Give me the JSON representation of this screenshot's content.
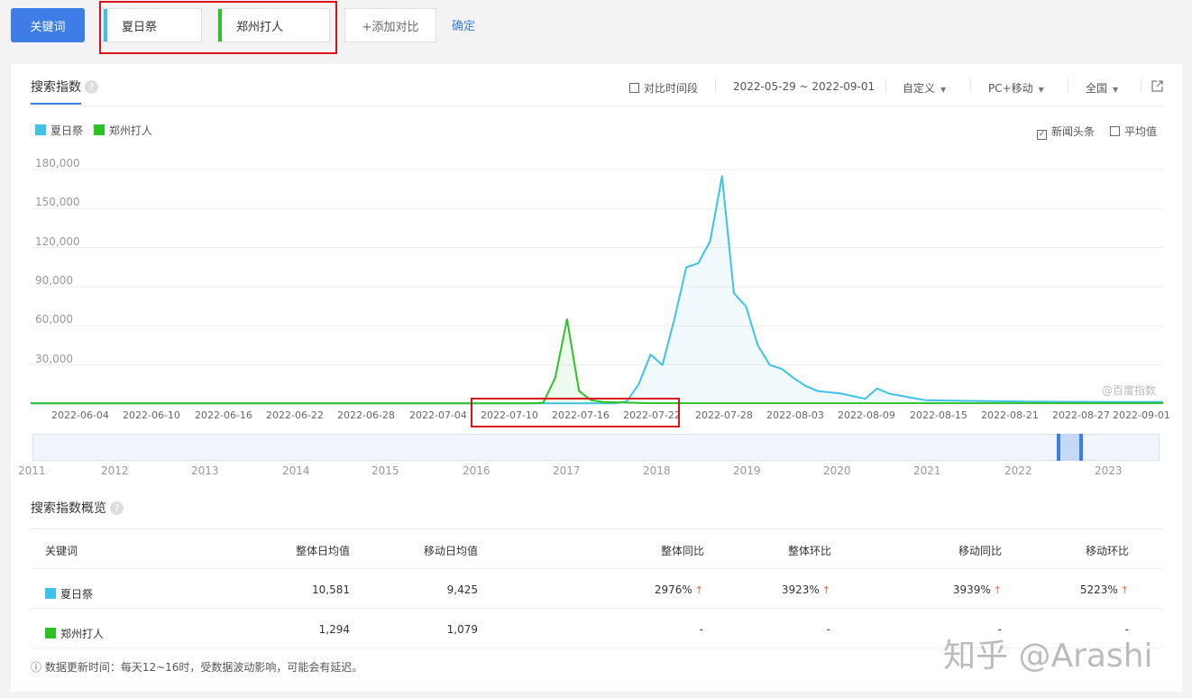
{
  "topbar": {
    "keyword_button": "关键词",
    "keywords": [
      "夏日祭",
      "郑州打人"
    ],
    "add_compare": "+添加对比",
    "confirm": "确定"
  },
  "panel": {
    "tab_title": "搜索指数",
    "help_glyph": "?",
    "compare_period": "对比时间段",
    "date_range": "2022-05-29 ~ 2022-09-01",
    "custom": "自定义",
    "device": "PC+移动",
    "region": "全国",
    "news_headlines": "新闻头条",
    "average": "平均值",
    "watermark": "@百度指数"
  },
  "chart_data": {
    "type": "area",
    "series": [
      {
        "name": "夏日祭",
        "color": "#3fc1e8",
        "x": [
          "2022-07-17",
          "2022-07-18",
          "2022-07-19",
          "2022-07-20",
          "2022-07-21",
          "2022-07-22",
          "2022-07-23",
          "2022-07-24",
          "2022-07-25",
          "2022-07-26",
          "2022-07-27",
          "2022-07-28",
          "2022-07-29",
          "2022-07-30",
          "2022-07-31",
          "2022-08-01",
          "2022-08-02",
          "2022-08-03",
          "2022-08-05",
          "2022-08-07",
          "2022-08-08",
          "2022-08-09",
          "2022-08-12",
          "2022-08-15",
          "2022-08-21",
          "2022-08-27",
          "2022-09-01"
        ],
        "values": [
          500,
          2000,
          15000,
          38000,
          30000,
          65000,
          105000,
          108000,
          125000,
          175000,
          85000,
          75000,
          45000,
          30000,
          27000,
          20000,
          14000,
          10000,
          8000,
          4000,
          12000,
          8000,
          3000,
          2500,
          1800,
          1600,
          1500
        ]
      },
      {
        "name": "郑州打人",
        "color": "#2ec128",
        "x": [
          "2022-07-10",
          "2022-07-11",
          "2022-07-12",
          "2022-07-13",
          "2022-07-14",
          "2022-07-15",
          "2022-07-16",
          "2022-07-20",
          "2022-07-28",
          "2022-09-01"
        ],
        "values": [
          500,
          1000,
          20000,
          65000,
          10000,
          3000,
          1500,
          600,
          600,
          600
        ]
      }
    ],
    "x_ticks": [
      "2022-06-04",
      "2022-06-10",
      "2022-06-16",
      "2022-06-22",
      "2022-06-28",
      "2022-07-04",
      "2022-07-10",
      "2022-07-16",
      "2022-07-22",
      "2022-07-28",
      "2022-08-03",
      "2022-08-09",
      "2022-08-15",
      "2022-08-21",
      "2022-08-27",
      "2022-09-01"
    ],
    "y_ticks": [
      "180,000",
      "150,000",
      "120,000",
      "90,000",
      "60,000",
      "30,000"
    ],
    "ylim": [
      0,
      180000
    ],
    "xlim": [
      "2022-05-29",
      "2022-09-01"
    ],
    "grid": true
  },
  "timeline": {
    "years": [
      "2011",
      "2012",
      "2013",
      "2014",
      "2015",
      "2016",
      "2017",
      "2018",
      "2019",
      "2020",
      "2021",
      "2022",
      "2023"
    ]
  },
  "overview": {
    "title": "搜索指数概览",
    "headers": [
      "关键词",
      "整体日均值",
      "移动日均值",
      "整体同比",
      "整体环比",
      "移动同比",
      "移动环比"
    ],
    "rows": [
      {
        "keyword": "夏日祭",
        "color": "#3fc1e8",
        "overall_avg": "10,581",
        "mobile_avg": "9,425",
        "yoy": "2976%",
        "mom": "3923%",
        "mobile_yoy": "3939%",
        "mobile_mom": "5223%"
      },
      {
        "keyword": "郑州打人",
        "color": "#2ec128",
        "overall_avg": "1,294",
        "mobile_avg": "1,079",
        "yoy": "-",
        "mom": "-",
        "mobile_yoy": "-",
        "mobile_mom": "-"
      }
    ],
    "up_glyph": "↑"
  },
  "footnote": "ⓘ 数据更新时间：每天12~16时，受数据波动影响，可能会有延迟。",
  "watermark": "知乎 @Arashi"
}
